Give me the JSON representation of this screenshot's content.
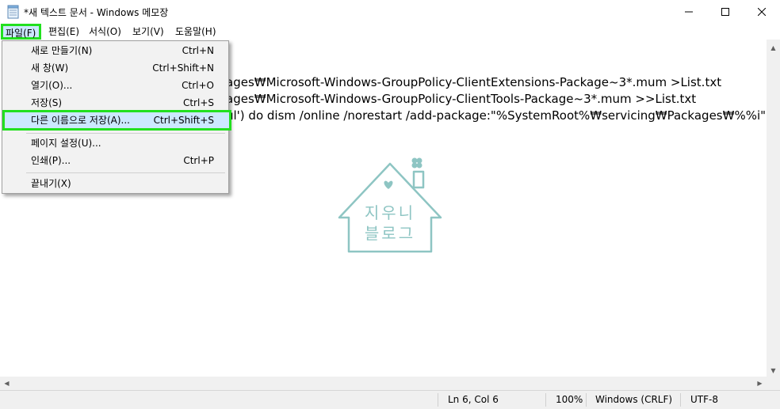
{
  "window": {
    "title": "*새 텍스트 문서 - Windows 메모장",
    "minimize_glyph": "—",
    "maximize_glyph": "☐",
    "close_glyph": "✕"
  },
  "menubar": {
    "file": "파일(F)",
    "edit": "편집(E)",
    "format": "서식(O)",
    "view": "보기(V)",
    "help": "도움말(H)"
  },
  "file_menu": {
    "items": [
      {
        "label": "새로 만들기(N)",
        "shortcut": "Ctrl+N"
      },
      {
        "label": "새 창(W)",
        "shortcut": "Ctrl+Shift+N"
      },
      {
        "label": "열기(O)...",
        "shortcut": "Ctrl+O"
      },
      {
        "label": "저장(S)",
        "shortcut": "Ctrl+S"
      },
      {
        "label": "다른 이름으로 저장(A)...",
        "shortcut": "Ctrl+Shift+S"
      },
      {
        "label": "페이지 설정(U)...",
        "shortcut": ""
      },
      {
        "label": "인쇄(P)...",
        "shortcut": "Ctrl+P"
      },
      {
        "label": "끝내기(X)",
        "shortcut": ""
      }
    ]
  },
  "editor": {
    "lines": [
      "ages₩Microsoft-Windows-GroupPolicy-ClientExtensions-Package~3*.mum >List.txt",
      "ages₩Microsoft-Windows-GroupPolicy-ClientTools-Package~3*.mum >>List.txt",
      "ul') do dism /online /norestart /add-package:\"%SystemRoot%₩servicing₩Packages₩%%i\""
    ]
  },
  "watermark": {
    "line1": "지우니",
    "line2": "블로그"
  },
  "statusbar": {
    "position": "Ln 6, Col 6",
    "zoom": "100%",
    "line_ending": "Windows (CRLF)",
    "encoding": "UTF-8"
  },
  "colors": {
    "highlight_border": "#22e01f",
    "menu_selected_bg": "#cce8ff",
    "watermark": "#8ec5c3"
  }
}
